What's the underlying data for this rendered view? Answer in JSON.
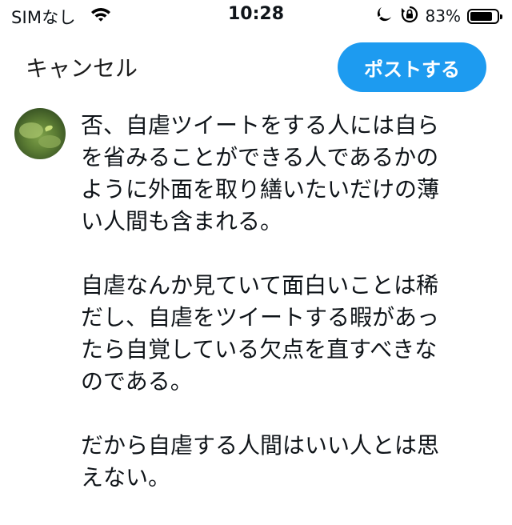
{
  "status_bar": {
    "carrier": "SIMなし",
    "time": "10:28",
    "battery_percent": "83%",
    "battery_level": 0.83,
    "icons": [
      "wifi-icon",
      "moon-icon",
      "orientation-lock-icon",
      "battery-icon"
    ]
  },
  "compose": {
    "cancel_label": "キャンセル",
    "post_label": "ポストする",
    "accent_color": "#1d9bf0",
    "paragraphs": [
      [
        "否、自虐ツイートをする人には自ら",
        "を省みることができる人であるかの",
        "ように外面を取り繕いたいだけの薄",
        "い人間も含まれる。"
      ],
      [
        "自虐なんか見ていて面白いことは稀",
        "だし、自虐をツイートする暇があっ",
        "たら自覚している欠点を直すべきな",
        "のである。"
      ],
      [
        "だから自虐する人間はいい人とは思",
        "えない。"
      ]
    ]
  }
}
